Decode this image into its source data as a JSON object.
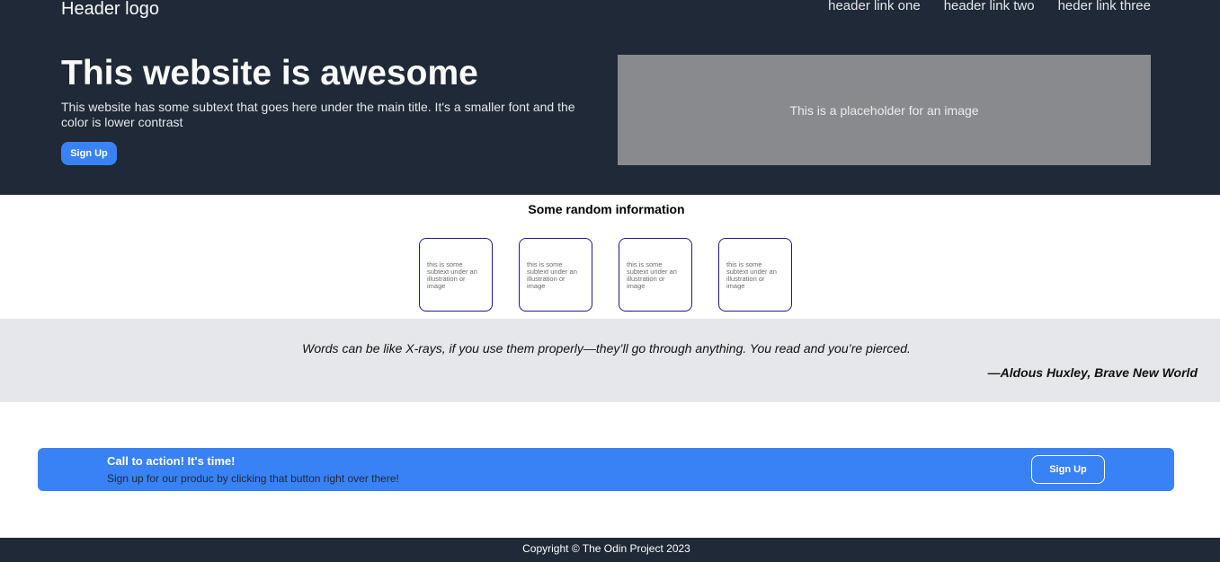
{
  "header": {
    "logo": "Header logo",
    "nav_links": [
      "header link one",
      "header link two",
      "heder link three"
    ]
  },
  "hero": {
    "title": "This website is awesome",
    "subtitle": "This website has some subtext that goes here under the main title. It's a smaller font and the color is lower contrast",
    "signup_label": "Sign Up",
    "image_placeholder": "This is a placeholder for an image"
  },
  "info": {
    "title": "Some random information",
    "cards": [
      "this is some subtext under an illustration or image",
      "this is some subtext under an illustration or image",
      "this is some subtext under an illustration or image",
      "this is some subtext under an illustration or image"
    ]
  },
  "quote": {
    "text": "Words can be like X-rays, if you use them properly—they’ll go through anything. You read and you’re pierced.",
    "author": "—Aldous Huxley, Brave New World"
  },
  "cta": {
    "title": "Call to action! It's time!",
    "subtitle": "Sign up for our produc by clicking that button right over there!",
    "button_label": "Sign Up"
  },
  "footer": {
    "copyright": "Copyright © The Odin Project 2023"
  },
  "colors": {
    "dark_bg": "#1f2937",
    "accent_blue": "#3882f6",
    "quote_bg": "#e5e7eb",
    "image_placeholder_bg": "#898a8e",
    "card_border": "#1c1c8c"
  }
}
